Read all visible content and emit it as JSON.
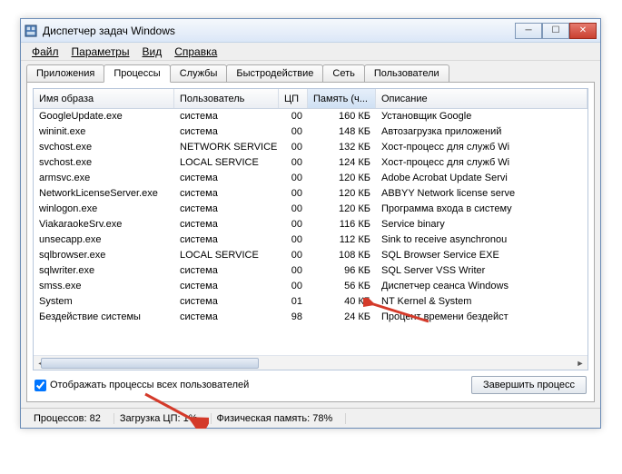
{
  "window": {
    "title": "Диспетчер задач Windows"
  },
  "menu": {
    "file": "Файл",
    "options": "Параметры",
    "view": "Вид",
    "help": "Справка"
  },
  "tabs": {
    "apps": "Приложения",
    "processes": "Процессы",
    "services": "Службы",
    "performance": "Быстродействие",
    "network": "Сеть",
    "users": "Пользователи"
  },
  "columns": {
    "image": "Имя образа",
    "user": "Пользователь",
    "cpu": "ЦП",
    "memory": "Память (ч...",
    "description": "Описание"
  },
  "rows": [
    {
      "img": "GoogleUpdate.exe",
      "user": "система",
      "cpu": "00",
      "mem": "160 КБ",
      "desc": "Установщик Google"
    },
    {
      "img": "wininit.exe",
      "user": "система",
      "cpu": "00",
      "mem": "148 КБ",
      "desc": "Автозагрузка приложений"
    },
    {
      "img": "svchost.exe",
      "user": "NETWORK SERVICE",
      "cpu": "00",
      "mem": "132 КБ",
      "desc": "Хост-процесс для служб Wi"
    },
    {
      "img": "svchost.exe",
      "user": "LOCAL SERVICE",
      "cpu": "00",
      "mem": "124 КБ",
      "desc": "Хост-процесс для служб Wi"
    },
    {
      "img": "armsvc.exe",
      "user": "система",
      "cpu": "00",
      "mem": "120 КБ",
      "desc": "Adobe Acrobat Update Servi"
    },
    {
      "img": "NetworkLicenseServer.exe",
      "user": "система",
      "cpu": "00",
      "mem": "120 КБ",
      "desc": "ABBYY Network license serve"
    },
    {
      "img": "winlogon.exe",
      "user": "система",
      "cpu": "00",
      "mem": "120 КБ",
      "desc": "Программа входа в систему"
    },
    {
      "img": "ViakaraokeSrv.exe",
      "user": "система",
      "cpu": "00",
      "mem": "116 КБ",
      "desc": "Service binary"
    },
    {
      "img": "unsecapp.exe",
      "user": "система",
      "cpu": "00",
      "mem": "112 КБ",
      "desc": "Sink to receive asynchronou"
    },
    {
      "img": "sqlbrowser.exe",
      "user": "LOCAL SERVICE",
      "cpu": "00",
      "mem": "108 КБ",
      "desc": "SQL Browser Service EXE"
    },
    {
      "img": "sqlwriter.exe",
      "user": "система",
      "cpu": "00",
      "mem": "96 КБ",
      "desc": "SQL Server VSS Writer"
    },
    {
      "img": "smss.exe",
      "user": "система",
      "cpu": "00",
      "mem": "56 КБ",
      "desc": "Диспетчер сеанса  Windows"
    },
    {
      "img": "System",
      "user": "система",
      "cpu": "01",
      "mem": "40 КБ",
      "desc": "NT Kernel & System"
    },
    {
      "img": "Бездействие системы",
      "user": "система",
      "cpu": "98",
      "mem": "24 КБ",
      "desc": "Процент времени бездейст"
    }
  ],
  "controls": {
    "show_all": "Отображать процессы всех пользователей",
    "end_process": "Завершить процесс"
  },
  "status": {
    "processes_label": "Процессов:",
    "processes_val": "82",
    "cpu_label": "Загрузка ЦП:",
    "cpu_val": "1%",
    "mem_label": "Физическая память:",
    "mem_val": "78%"
  }
}
